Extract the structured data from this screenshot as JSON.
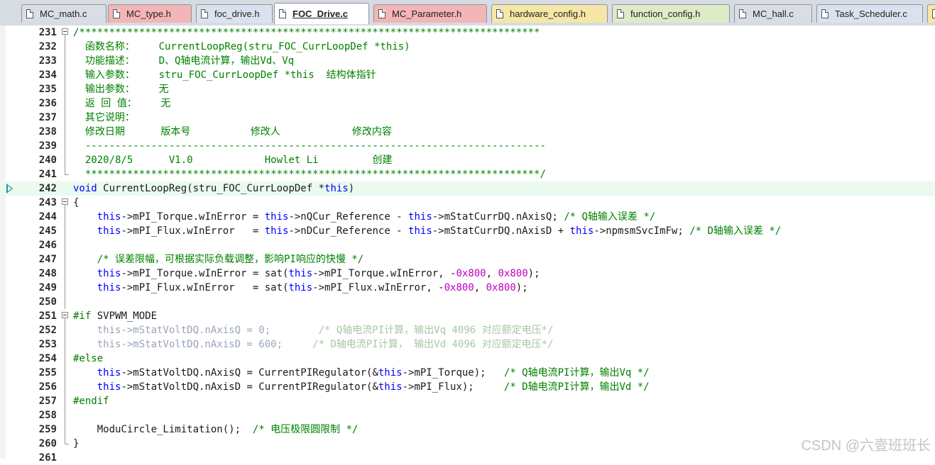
{
  "tabs": [
    {
      "label": "MC_math.c",
      "color": "#d9dde5",
      "active": false
    },
    {
      "label": "MC_type.h",
      "color": "#f3b5b5",
      "active": false
    },
    {
      "label": "foc_drive.h",
      "color": "#dbe2ef",
      "active": false
    },
    {
      "label": "FOC_Drive.c",
      "color": "#ffffff",
      "active": true
    },
    {
      "label": "MC_Parameter.h",
      "color": "#f3b5b5",
      "active": false
    },
    {
      "label": "hardware_config.h",
      "color": "#f7e7a6",
      "active": false
    },
    {
      "label": "function_config.h",
      "color": "#dfeac7",
      "active": false
    },
    {
      "label": "MC_hall.c",
      "color": "#d9dde5",
      "active": false
    },
    {
      "label": "Task_Scheduler.c",
      "color": "#dbe2ef",
      "active": false
    },
    {
      "label": "",
      "color": "#f7e7a6",
      "active": false
    }
  ],
  "current_line": 242,
  "lines": [
    {
      "n": "231",
      "fold": "box",
      "segs": [
        [
          "c",
          "/*****************************************************************************"
        ]
      ]
    },
    {
      "n": "232",
      "fold": "bar",
      "segs": [
        [
          "c",
          "  函数名称：    CurrentLoopReg(stru_FOC_CurrLoopDef *this)"
        ]
      ]
    },
    {
      "n": "233",
      "fold": "bar",
      "segs": [
        [
          "c",
          "  功能描述：    D、Q轴电流计算，输出Vd、Vq"
        ]
      ]
    },
    {
      "n": "234",
      "fold": "bar",
      "segs": [
        [
          "c",
          "  输入参数：    stru_FOC_CurrLoopDef *this  结构体指针"
        ]
      ]
    },
    {
      "n": "235",
      "fold": "bar",
      "segs": [
        [
          "c",
          "  输出参数：    无"
        ]
      ]
    },
    {
      "n": "236",
      "fold": "bar",
      "segs": [
        [
          "c",
          "  返 回 值：    无"
        ]
      ]
    },
    {
      "n": "237",
      "fold": "bar",
      "segs": [
        [
          "c",
          "  其它说明："
        ]
      ]
    },
    {
      "n": "238",
      "fold": "bar",
      "segs": [
        [
          "c",
          "  修改日期      版本号          修改人            修改内容"
        ]
      ]
    },
    {
      "n": "239",
      "fold": "bar",
      "segs": [
        [
          "c",
          "  -----------------------------------------------------------------------------"
        ]
      ]
    },
    {
      "n": "240",
      "fold": "bar",
      "segs": [
        [
          "c",
          "  2020/8/5      V1.0            Howlet Li         创建"
        ]
      ]
    },
    {
      "n": "241",
      "fold": "end",
      "segs": [
        [
          "c",
          "  ****************************************************************************/"
        ]
      ]
    },
    {
      "n": "242",
      "fold": "",
      "segs": [
        [
          "k",
          "void"
        ],
        [
          "t",
          " CurrentLoopReg(stru_FOC_CurrLoopDef *"
        ],
        [
          "k",
          "this"
        ],
        [
          "t",
          ")"
        ]
      ]
    },
    {
      "n": "243",
      "fold": "box",
      "segs": [
        [
          "t",
          "{"
        ]
      ]
    },
    {
      "n": "244",
      "fold": "bar",
      "segs": [
        [
          "t",
          "    "
        ],
        [
          "k",
          "this"
        ],
        [
          "t",
          "->mPI_Torque.wInError = "
        ],
        [
          "k",
          "this"
        ],
        [
          "t",
          "->nQCur_Reference - "
        ],
        [
          "k",
          "this"
        ],
        [
          "t",
          "->mStatCurrDQ.nAxisQ; "
        ],
        [
          "c",
          "/* Q轴输入误差 */"
        ]
      ]
    },
    {
      "n": "245",
      "fold": "bar",
      "segs": [
        [
          "t",
          "    "
        ],
        [
          "k",
          "this"
        ],
        [
          "t",
          "->mPI_Flux.wInError   = "
        ],
        [
          "k",
          "this"
        ],
        [
          "t",
          "->nDCur_Reference - "
        ],
        [
          "k",
          "this"
        ],
        [
          "t",
          "->mStatCurrDQ.nAxisD + "
        ],
        [
          "k",
          "this"
        ],
        [
          "t",
          "->npmsmSvcImFw; "
        ],
        [
          "c",
          "/* D轴输入误差 */"
        ]
      ]
    },
    {
      "n": "246",
      "fold": "bar",
      "segs": []
    },
    {
      "n": "247",
      "fold": "bar",
      "segs": [
        [
          "c",
          "    /* 误差限幅，可根据实际负载调整，影响PI响应的快慢 */"
        ]
      ]
    },
    {
      "n": "248",
      "fold": "bar",
      "segs": [
        [
          "t",
          "    "
        ],
        [
          "k",
          "this"
        ],
        [
          "t",
          "->mPI_Torque.wInError = sat("
        ],
        [
          "k",
          "this"
        ],
        [
          "t",
          "->mPI_Torque.wInError, -"
        ],
        [
          "h",
          "0x800"
        ],
        [
          "t",
          ", "
        ],
        [
          "h",
          "0x800"
        ],
        [
          "t",
          ");"
        ]
      ]
    },
    {
      "n": "249",
      "fold": "bar",
      "segs": [
        [
          "t",
          "    "
        ],
        [
          "k",
          "this"
        ],
        [
          "t",
          "->mPI_Flux.wInError   = sat("
        ],
        [
          "k",
          "this"
        ],
        [
          "t",
          "->mPI_Flux.wInError, -"
        ],
        [
          "h",
          "0x800"
        ],
        [
          "t",
          ", "
        ],
        [
          "h",
          "0x800"
        ],
        [
          "t",
          ");"
        ]
      ]
    },
    {
      "n": "250",
      "fold": "bar",
      "segs": []
    },
    {
      "n": "251",
      "fold": "box",
      "segs": [
        [
          "c",
          "#if"
        ],
        [
          "t",
          " SVPWM_MODE"
        ]
      ]
    },
    {
      "n": "252",
      "fold": "bar",
      "segs": [
        [
          "g",
          "    this->mStatVoltDQ.nAxisQ = 0;        "
        ],
        [
          "gc",
          "/* Q轴电流PI计算，输出Vq 4096 对应额定电压*/"
        ]
      ]
    },
    {
      "n": "253",
      "fold": "bar",
      "segs": [
        [
          "g",
          "    this->mStatVoltDQ.nAxisD = 600;     "
        ],
        [
          "gc",
          "/* D轴电流PI计算， 输出Vd 4096 对应额定电压*/"
        ]
      ]
    },
    {
      "n": "254",
      "fold": "bar",
      "segs": [
        [
          "c",
          "#else"
        ]
      ]
    },
    {
      "n": "255",
      "fold": "bar",
      "segs": [
        [
          "t",
          "    "
        ],
        [
          "k",
          "this"
        ],
        [
          "t",
          "->mStatVoltDQ.nAxisQ = CurrentPIRegulator(&"
        ],
        [
          "k",
          "this"
        ],
        [
          "t",
          "->mPI_Torque);   "
        ],
        [
          "c",
          "/* Q轴电流PI计算，输出Vq */"
        ]
      ]
    },
    {
      "n": "256",
      "fold": "bar",
      "segs": [
        [
          "t",
          "    "
        ],
        [
          "k",
          "this"
        ],
        [
          "t",
          "->mStatVoltDQ.nAxisD = CurrentPIRegulator(&"
        ],
        [
          "k",
          "this"
        ],
        [
          "t",
          "->mPI_Flux);     "
        ],
        [
          "c",
          "/* D轴电流PI计算，输出Vd */"
        ]
      ]
    },
    {
      "n": "257",
      "fold": "bar",
      "segs": [
        [
          "c",
          "#endif"
        ]
      ]
    },
    {
      "n": "258",
      "fold": "bar",
      "segs": []
    },
    {
      "n": "259",
      "fold": "bar",
      "segs": [
        [
          "t",
          "    ModuCircle_Limitation();  "
        ],
        [
          "c",
          "/* 电压极限圆限制 */"
        ]
      ]
    },
    {
      "n": "260",
      "fold": "end",
      "segs": [
        [
          "t",
          "}"
        ]
      ]
    },
    {
      "n": "261",
      "fold": "",
      "segs": []
    }
  ],
  "watermark": "CSDN @六壹班班长"
}
